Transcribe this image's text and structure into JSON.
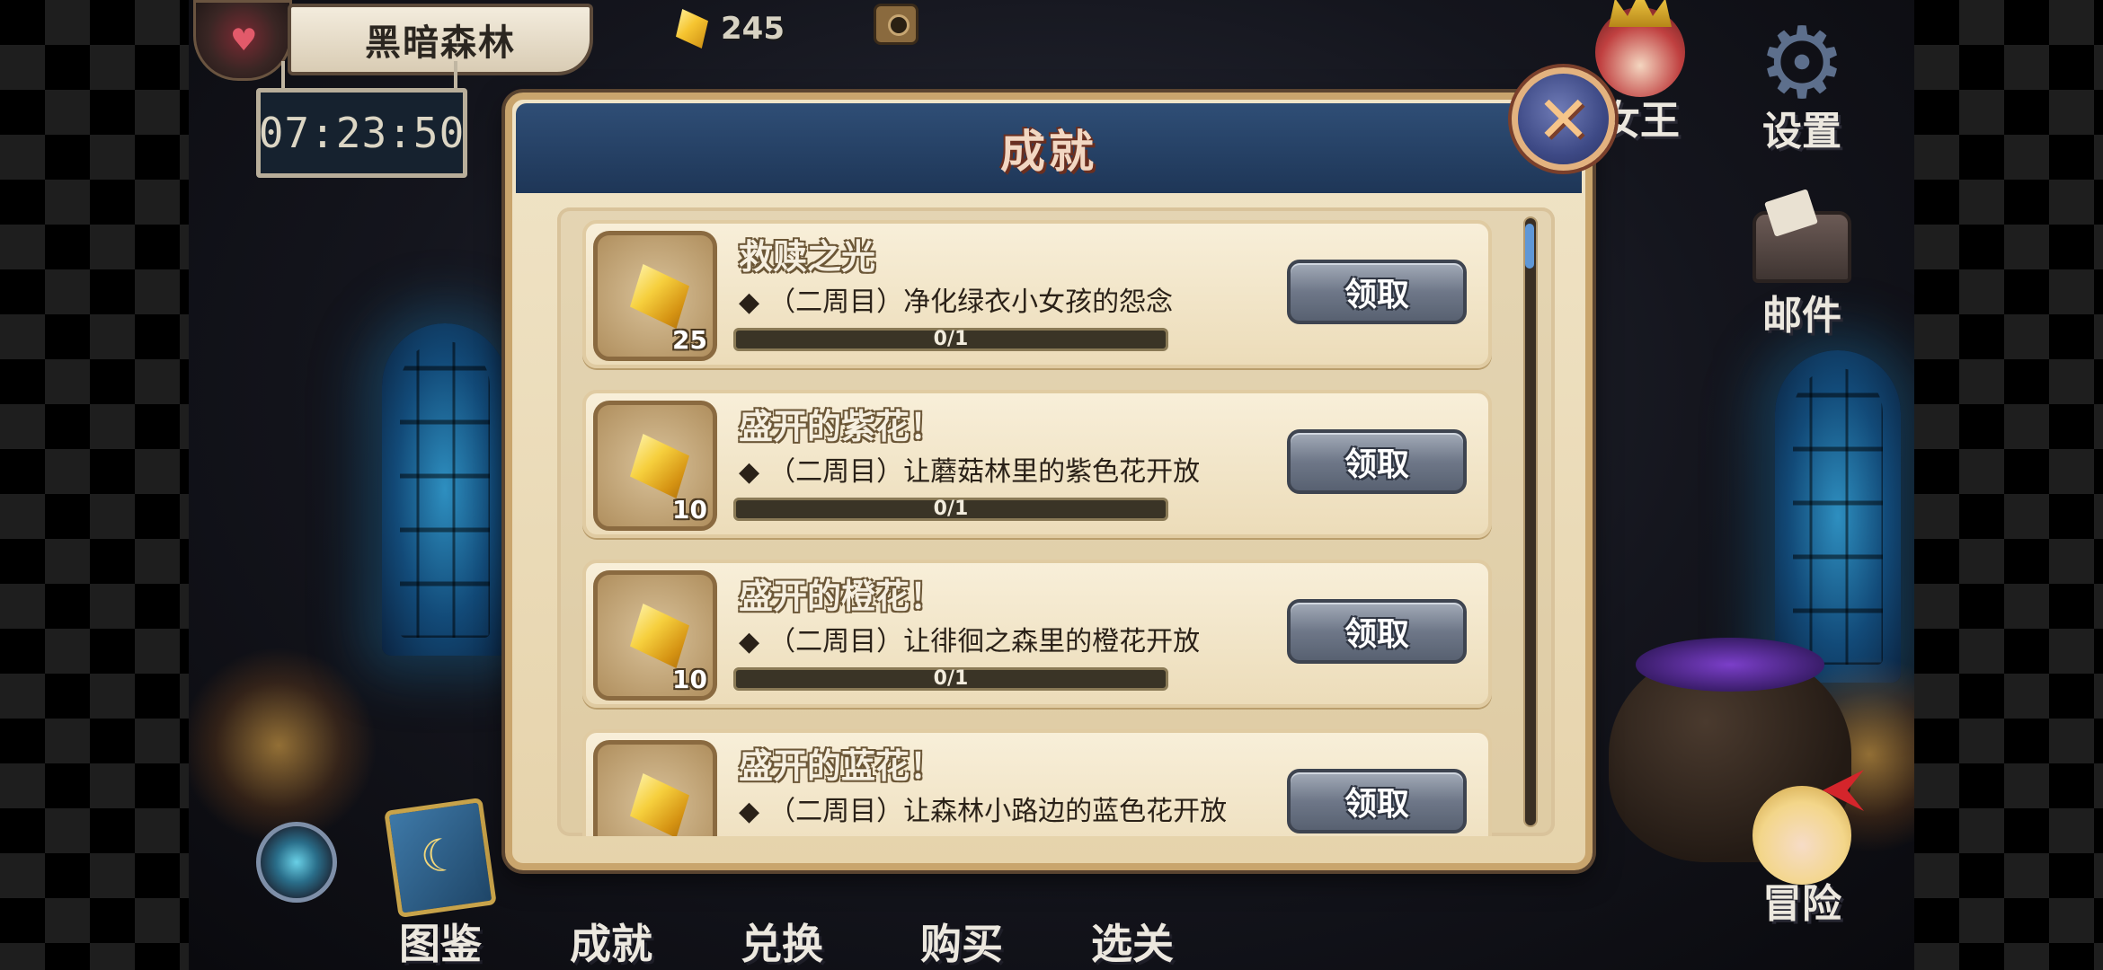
{
  "location": {
    "name": "黑暗森林"
  },
  "currency": {
    "gems": "245"
  },
  "timer": {
    "value": "07:23:50"
  },
  "right_menu": {
    "queen_label": "女王",
    "settings_label": "设置",
    "mail_label": "邮件",
    "adventure_label": "冒险"
  },
  "bottom_menu": {
    "items": [
      {
        "label": "图鉴"
      },
      {
        "label": "成就"
      },
      {
        "label": "兑换"
      },
      {
        "label": "购买"
      },
      {
        "label": "选关"
      }
    ]
  },
  "modal": {
    "title": "成就",
    "close_icon": "✕",
    "achievements": [
      {
        "title": "救赎之光",
        "bullet": "◆",
        "description": "（二周目）净化绿衣小女孩的怨念",
        "reward": "25",
        "progress_text": "0/1",
        "progress": 0,
        "button": "领取"
      },
      {
        "title": "盛开的紫花！",
        "bullet": "◆",
        "description": "（二周目）让蘑菇林里的紫色花开放",
        "reward": "10",
        "progress_text": "0/1",
        "progress": 0,
        "button": "领取"
      },
      {
        "title": "盛开的橙花！",
        "bullet": "◆",
        "description": "（二周目）让徘徊之森里的橙花开放",
        "reward": "10",
        "progress_text": "0/1",
        "progress": 0,
        "button": "领取"
      },
      {
        "title": "盛开的蓝花！",
        "bullet": "◆",
        "description": "（二周目）让森林小路边的蓝色花开放",
        "reward": "",
        "progress_text": "",
        "progress": 0,
        "button": "领取"
      }
    ]
  },
  "colors": {
    "header_blue": "#1e3657",
    "parchment": "#f0e4c7",
    "gem_gold": "#f6cf3d",
    "button_grey": "#6e7788"
  },
  "icons": {
    "close": "close-icon",
    "gem": "gem-icon",
    "settings": "gear-icon",
    "mail": "mail-icon",
    "camera": "camera-icon"
  }
}
